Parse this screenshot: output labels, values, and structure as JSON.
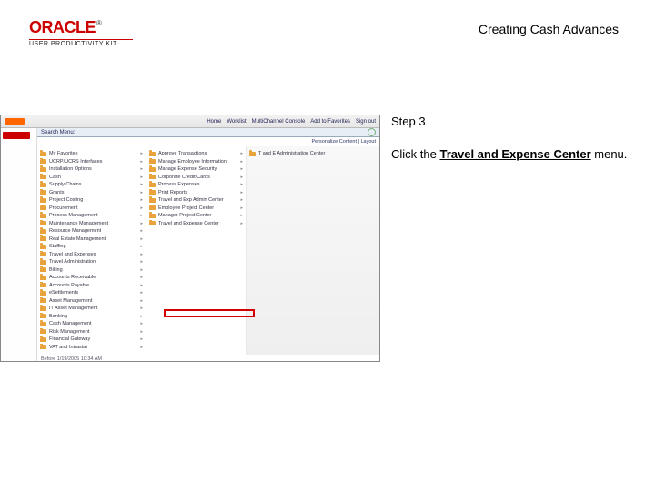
{
  "logo": {
    "brand": "ORACLE",
    "tm": "®",
    "subtitle": "USER PRODUCTIVITY KIT"
  },
  "doc_title": "Creating Cash Advances",
  "instruction": {
    "step_label": "Step 3",
    "pre": "Click the ",
    "bold": "Travel and Expense Center",
    "post": " menu."
  },
  "ss": {
    "top_orange": " ",
    "top_links": [
      "Home",
      "Worklist",
      "MultiChannel Console",
      "Add to Favorites",
      "Sign out"
    ],
    "menu_header": "Search Menu:",
    "personalize": "Personalize Content | Layout",
    "left_items": [
      "My Favorites",
      "UCRP/UCRS Interfaces",
      "Installation Options",
      "Cash",
      "Supply Chains",
      "Grants",
      "Project Costing",
      "Procurement",
      "Process Management",
      "Maintenance Management",
      "Resource Management",
      "Real Estate Management",
      "Staffing",
      "Travel and Expenses",
      "Travel Administration",
      "Billing",
      "Accounts Receivable",
      "Accounts Payable",
      "eSettlements",
      "Asset Management",
      "IT Asset Management",
      "Banking",
      "Cash Management",
      "Risk Management",
      "Financial Gateway",
      "VAT and Intrastat"
    ],
    "mid_items": [
      "Approve Transactions",
      "Manage Employee Information",
      "Manage Expense Security",
      "Corporate Credit Cards",
      "Process Expenses",
      "Print Reports",
      "Travel and Exp Admin Center",
      "Employee Project Center",
      "Manager Project Center",
      "Travel and Expense Center"
    ],
    "right_item": "T and E Administration Center",
    "footer": "Before 1/19/2005  10:34 AM"
  }
}
